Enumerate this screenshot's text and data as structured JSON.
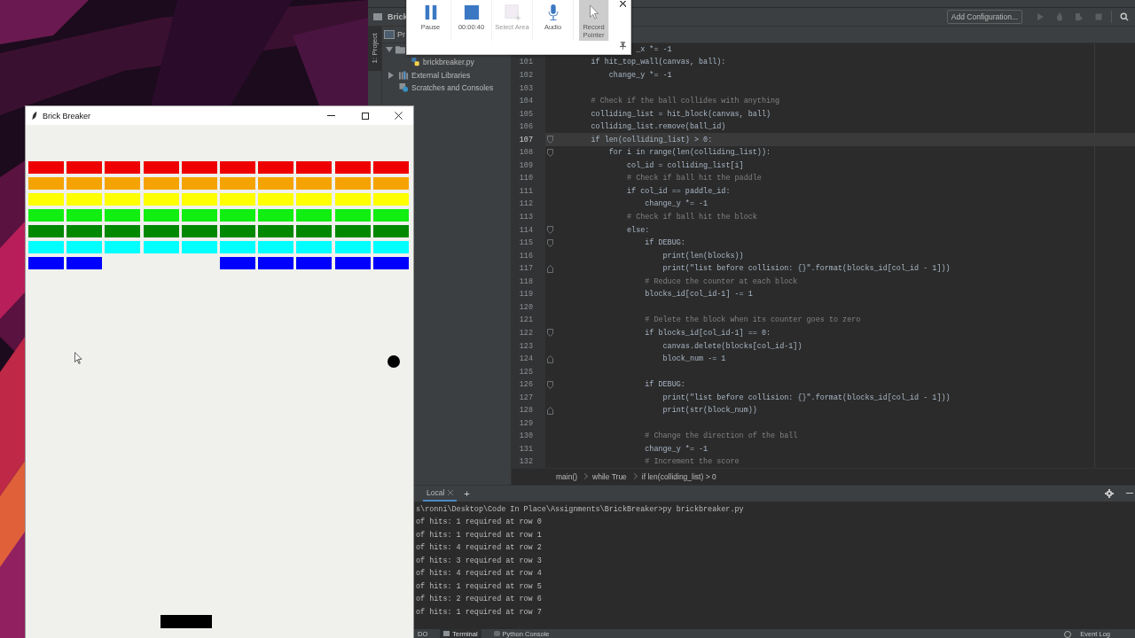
{
  "ide": {
    "project_crumb": "Brick",
    "add_configuration": "Add Configuration...",
    "tool_strip_label": "1: Project",
    "project_panel": {
      "header": "Pr",
      "tree": [
        {
          "kind": "folder",
          "expanded": true,
          "children": [
            {
              "kind": "python",
              "label": "brickbreaker.py"
            }
          ]
        },
        {
          "kind": "library",
          "label": "External Libraries",
          "expanded": false
        },
        {
          "kind": "scratches",
          "label": "Scratches and Consoles"
        }
      ]
    },
    "editor": {
      "lines": [
        {
          "text": "                  _x *= -1",
          "kind": "code",
          "current": false
        },
        {
          "number": "101",
          "text": "        if hit_top_wall(canvas, ball):",
          "kind": "code",
          "current": false
        },
        {
          "number": "102",
          "text": "            change_y *= -1",
          "kind": "code",
          "current": false
        },
        {
          "number": "103",
          "current": false
        },
        {
          "number": "104",
          "text": "        # Check if the ball collides with anything",
          "kind": "comment",
          "current": false
        },
        {
          "number": "105",
          "text": "        colliding_list = hit_block(canvas, ball)",
          "kind": "code",
          "current": false
        },
        {
          "number": "106",
          "text": "        colliding_list.remove(ball_id)",
          "kind": "code",
          "current": false
        },
        {
          "number": "107",
          "text": "        if len(colliding_list) > 0:",
          "kind": "code",
          "current": true,
          "fold_start": true
        },
        {
          "number": "108",
          "text": "            for i in range(len(colliding_list)):",
          "kind": "code",
          "current": false,
          "fold_start": true
        },
        {
          "number": "109",
          "text": "                col_id = colliding_list[i]",
          "kind": "code",
          "current": false
        },
        {
          "number": "110",
          "text": "                # Check if ball hit the paddle",
          "kind": "comment",
          "current": false
        },
        {
          "number": "111",
          "text": "                if col_id == paddle_id:",
          "kind": "code",
          "current": false
        },
        {
          "number": "112",
          "text": "                    change_y *= -1",
          "kind": "code",
          "current": false
        },
        {
          "number": "113",
          "text": "                # Check if ball hit the block",
          "kind": "comment",
          "current": false
        },
        {
          "number": "114",
          "text": "                else:",
          "kind": "code",
          "current": false,
          "fold_start": true
        },
        {
          "number": "115",
          "text": "                    if DEBUG:",
          "kind": "code",
          "current": false,
          "fold_start": true
        },
        {
          "number": "116",
          "text": "                        print(len(blocks))",
          "kind": "code",
          "current": false
        },
        {
          "number": "117",
          "text": "                        print(\"list before collision: {}\".format(blocks_id[col_id - 1]))",
          "kind": "code",
          "current": false,
          "fold_end": true
        },
        {
          "number": "118",
          "text": "                    # Reduce the counter at each block",
          "kind": "comment",
          "current": false
        },
        {
          "number": "119",
          "text": "                    blocks_id[col_id-1] -= 1",
          "kind": "code",
          "current": false
        },
        {
          "number": "120",
          "current": false
        },
        {
          "number": "121",
          "text": "                    # Delete the block when its counter goes to zero",
          "kind": "comment",
          "current": false
        },
        {
          "number": "122",
          "text": "                    if blocks_id[col_id-1] == 0:",
          "kind": "code",
          "current": false,
          "fold_start": true
        },
        {
          "number": "123",
          "text": "                        canvas.delete(blocks[col_id-1])",
          "kind": "code",
          "current": false
        },
        {
          "number": "124",
          "text": "                        block_num -= 1",
          "kind": "code",
          "current": false,
          "fold_end": true
        },
        {
          "number": "125",
          "current": false
        },
        {
          "number": "126",
          "text": "                    if DEBUG:",
          "kind": "code",
          "current": false,
          "fold_start": true
        },
        {
          "number": "127",
          "text": "                        print(\"list before collision: {}\".format(blocks_id[col_id - 1]))",
          "kind": "code",
          "current": false
        },
        {
          "number": "128",
          "text": "                        print(str(block_num))",
          "kind": "code",
          "current": false,
          "fold_end": true
        },
        {
          "number": "129",
          "current": false
        },
        {
          "number": "130",
          "text": "                    # Change the direction of the ball",
          "kind": "comment",
          "current": false
        },
        {
          "number": "131",
          "text": "                    change_y *= -1",
          "kind": "code",
          "current": false
        },
        {
          "number": "132",
          "text": "                    # Increment the score",
          "kind": "comment",
          "current": false
        }
      ]
    },
    "breadcrumbs": [
      "main()",
      "while True",
      "if len(colliding_list) > 0"
    ],
    "terminal": {
      "tabs": [
        {
          "label": "Local",
          "selected": true
        }
      ],
      "add": "+",
      "lines": [
        "s\\ronni\\Desktop\\Code In Place\\Assignments\\BrickBreaker>py brickbreaker.py",
        "of hits: 1 required at row 0",
        "of hits: 1 required at row 1",
        "of hits: 4 required at row 2",
        "of hits: 3 required at row 3",
        "of hits: 4 required at row 4",
        "of hits: 1 required at row 5",
        "of hits: 2 required at row 6",
        "of hits: 1 required at row 7"
      ]
    },
    "bottom_tabs": [
      {
        "label": "DO",
        "kind": "todo",
        "selected": false
      },
      {
        "label": "Terminal",
        "kind": "terminal",
        "selected": true
      },
      {
        "label": "Python Console",
        "kind": "console",
        "selected": false
      }
    ],
    "event_log": "Event Log"
  },
  "recorder": {
    "buttons": [
      {
        "label": "Pause",
        "kind": "pause",
        "disabled": false,
        "selected": false
      },
      {
        "label": "00:00:40",
        "kind": "stop",
        "disabled": false,
        "selected": false
      },
      {
        "label": "Select Area",
        "kind": "area",
        "disabled": true,
        "selected": false
      },
      {
        "label": "Audio",
        "kind": "audio",
        "disabled": false,
        "selected": false
      },
      {
        "label": "Record Pointer",
        "kind": "pointer",
        "disabled": false,
        "selected": true
      }
    ]
  },
  "game": {
    "title": "Brick Breaker",
    "rows": [
      {
        "color": "#ee0000",
        "bricks": [
          {
            "broken": false
          },
          {
            "broken": false
          },
          {
            "broken": false
          },
          {
            "broken": false
          },
          {
            "broken": false
          },
          {
            "broken": false
          },
          {
            "broken": false
          },
          {
            "broken": false
          },
          {
            "broken": false
          },
          {
            "broken": false
          }
        ]
      },
      {
        "color": "#f5a300",
        "bricks": [
          {
            "broken": false
          },
          {
            "broken": false
          },
          {
            "broken": false
          },
          {
            "broken": false
          },
          {
            "broken": false
          },
          {
            "broken": false
          },
          {
            "broken": false
          },
          {
            "broken": false
          },
          {
            "broken": false
          },
          {
            "broken": false
          }
        ]
      },
      {
        "color": "#ffff00",
        "bricks": [
          {
            "broken": false
          },
          {
            "broken": false
          },
          {
            "broken": false
          },
          {
            "broken": false
          },
          {
            "broken": false
          },
          {
            "broken": false
          },
          {
            "broken": false
          },
          {
            "broken": false
          },
          {
            "broken": false
          },
          {
            "broken": false
          }
        ]
      },
      {
        "color": "#11ee11",
        "bricks": [
          {
            "broken": false
          },
          {
            "broken": false
          },
          {
            "broken": false
          },
          {
            "broken": false
          },
          {
            "broken": false
          },
          {
            "broken": false
          },
          {
            "broken": false
          },
          {
            "broken": false
          },
          {
            "broken": false
          },
          {
            "broken": false
          }
        ]
      },
      {
        "color": "#008800",
        "bricks": [
          {
            "broken": false
          },
          {
            "broken": false
          },
          {
            "broken": false
          },
          {
            "broken": false
          },
          {
            "broken": false
          },
          {
            "broken": false
          },
          {
            "broken": false
          },
          {
            "broken": false
          },
          {
            "broken": false
          },
          {
            "broken": false
          }
        ]
      },
      {
        "color": "#00ffff",
        "bricks": [
          {
            "broken": false
          },
          {
            "broken": false
          },
          {
            "broken": false
          },
          {
            "broken": false
          },
          {
            "broken": false
          },
          {
            "broken": false
          },
          {
            "broken": false
          },
          {
            "broken": false
          },
          {
            "broken": false
          },
          {
            "broken": false
          }
        ]
      },
      {
        "color": "#0000ff",
        "bricks": [
          {
            "broken": false
          },
          {
            "broken": false
          },
          {
            "broken": true
          },
          {
            "broken": true
          },
          {
            "broken": true
          },
          {
            "broken": false
          },
          {
            "broken": false
          },
          {
            "broken": false
          },
          {
            "broken": false
          },
          {
            "broken": false
          }
        ]
      }
    ]
  }
}
